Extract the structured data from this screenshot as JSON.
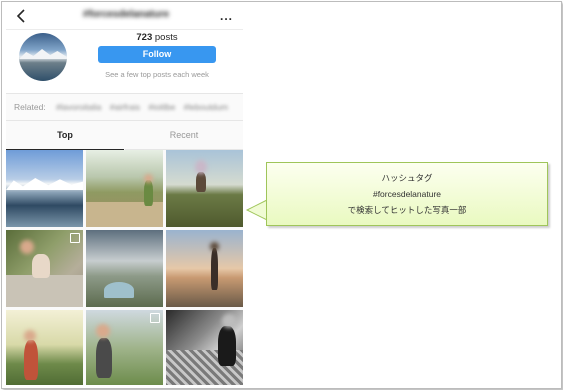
{
  "header": {
    "hashtag_title": "#forcesdelanature",
    "more_label": "..."
  },
  "profile": {
    "posts_count": "723",
    "posts_label": "posts",
    "follow_label": "Follow",
    "sub_note": "See a few top posts each week"
  },
  "related": {
    "label": "Related:",
    "tags": [
      "#lavoroitalia",
      "#airfrais",
      "#ioitlbe",
      "#leboutdum"
    ]
  },
  "tabs": {
    "top": "Top",
    "recent": "Recent"
  },
  "callout": {
    "line1": "ハッシュタグ",
    "line2": "#forcesdelanature",
    "line3": "で検索してヒットした写真一部"
  },
  "colors": {
    "follow_button": "#3897f0",
    "callout_border": "#9fc55a",
    "callout_fill": "#e9f9c0"
  },
  "icons": [
    "back-chevron-icon",
    "more-icon",
    "multi-photo-icon"
  ]
}
